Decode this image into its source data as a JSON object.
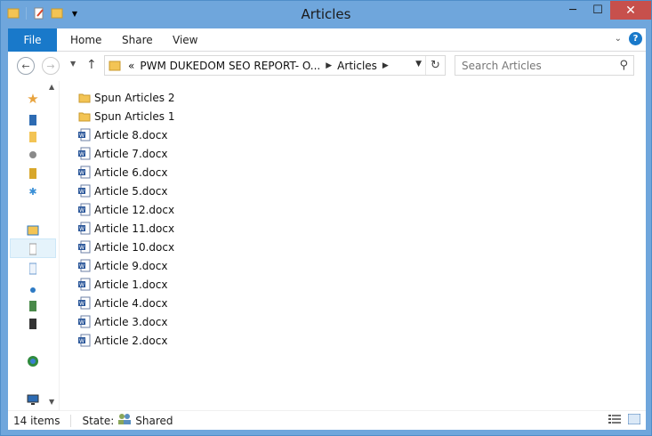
{
  "window": {
    "title": "Articles"
  },
  "ribbon": {
    "file": "File",
    "tabs": [
      "Home",
      "Share",
      "View"
    ]
  },
  "address": {
    "recent": "«",
    "path": [
      "PWM DUKEDOM SEO REPORT- O...",
      "Articles"
    ]
  },
  "search": {
    "placeholder": "Search Articles"
  },
  "files": [
    {
      "name": "Spun Articles 2",
      "type": "folder"
    },
    {
      "name": "Spun Articles 1",
      "type": "folder"
    },
    {
      "name": "Article 8.docx",
      "type": "docx"
    },
    {
      "name": "Article 7.docx",
      "type": "docx"
    },
    {
      "name": "Article 6.docx",
      "type": "docx"
    },
    {
      "name": "Article 5.docx",
      "type": "docx"
    },
    {
      "name": "Article 12.docx",
      "type": "docx"
    },
    {
      "name": "Article 11.docx",
      "type": "docx"
    },
    {
      "name": "Article 10.docx",
      "type": "docx"
    },
    {
      "name": "Article 9.docx",
      "type": "docx"
    },
    {
      "name": "Article 1.docx",
      "type": "docx"
    },
    {
      "name": "Article 4.docx",
      "type": "docx"
    },
    {
      "name": "Article 3.docx",
      "type": "docx"
    },
    {
      "name": "Article 2.docx",
      "type": "docx"
    }
  ],
  "status": {
    "count": "14 items",
    "state_label": "State:",
    "state_value": "Shared"
  },
  "colors": {
    "accent": "#1979ca",
    "frame": "#6fa6dc",
    "close": "#c7504c",
    "folder": "#f3c454",
    "word": "#2b579a"
  }
}
